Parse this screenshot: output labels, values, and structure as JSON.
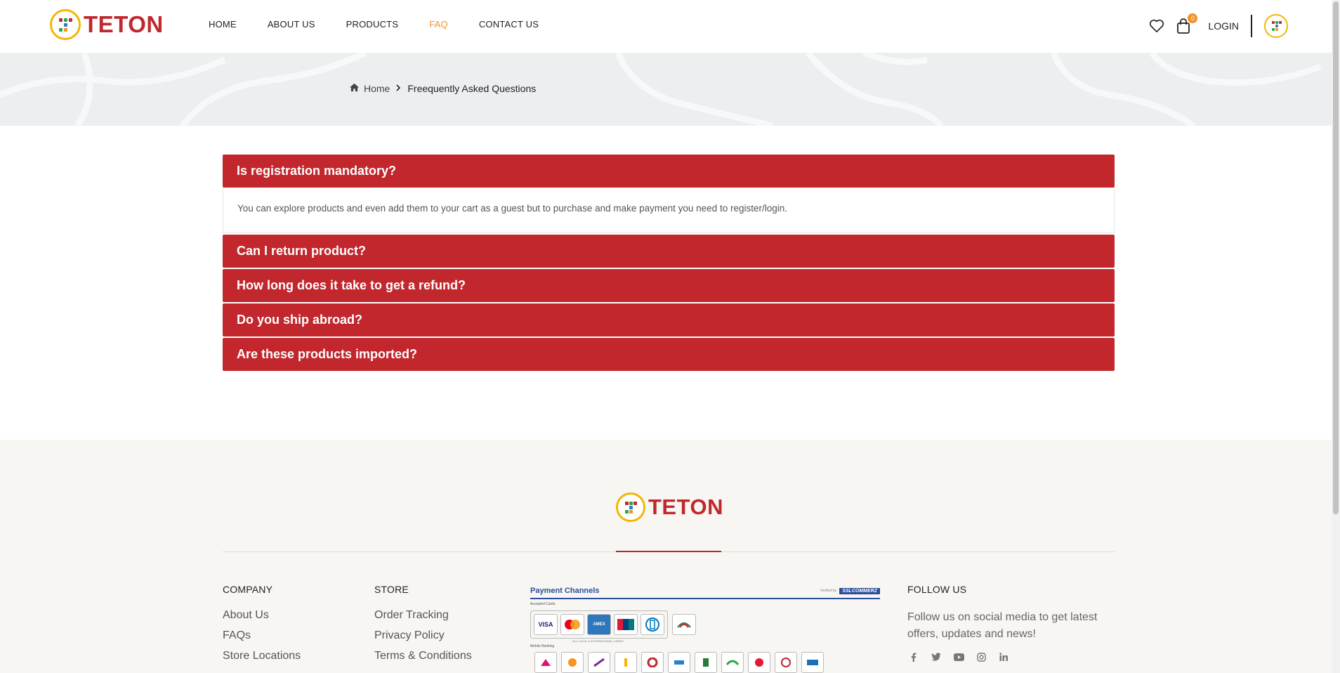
{
  "brand": {
    "name": "TETON",
    "primary": "#c1272d",
    "accent": "#f0932b",
    "logo_ring": "#f2b705"
  },
  "nav": {
    "items": [
      {
        "label": "HOME",
        "active": false
      },
      {
        "label": "ABOUT US",
        "active": false
      },
      {
        "label": "PRODUCTS",
        "active": false
      },
      {
        "label": "FAQ",
        "active": true
      },
      {
        "label": "CONTACT US",
        "active": false
      }
    ]
  },
  "header": {
    "wishlist_icon": "heart-icon",
    "cart_icon": "shopping-bag-icon",
    "cart_count": "0",
    "login_label": "LOGIN",
    "avatar_icon": "user-avatar-icon"
  },
  "breadcrumb": {
    "home_icon": "home-icon",
    "home_label": "Home",
    "separator_icon": "chevron-right-icon",
    "current": "Freequently Asked Questions"
  },
  "faq": {
    "items": [
      {
        "question": "Is registration mandatory?",
        "answer": "You can explore products and even add them to your cart as a guest but to purchase and make payment you need to register/login.",
        "expanded": true
      },
      {
        "question": "Can I return product?",
        "expanded": false
      },
      {
        "question": "How long does it take to get a refund?",
        "expanded": false
      },
      {
        "question": "Do you ship abroad?",
        "expanded": false
      },
      {
        "question": "Are these products imported?",
        "expanded": false
      }
    ]
  },
  "footer": {
    "company": {
      "title": "COMPANY",
      "links": [
        "About Us",
        "FAQs",
        "Store Locations"
      ]
    },
    "store": {
      "title": "STORE",
      "links": [
        "Order Tracking",
        "Privacy Policy",
        "Terms & Conditions"
      ]
    },
    "payment": {
      "title": "Payment Channels",
      "verified_by": "Verified by",
      "verifier": "SSLCOMMERZ",
      "accepted_label": "Accepted Cards",
      "cards": [
        "VISA",
        "mastercard",
        "AMEX",
        "UnionPay",
        "Diners",
        "DBBL NEXUS"
      ],
      "cards_caption": "ALL LOCAL & INTERNATIONAL CARDS",
      "mobile_label": "Mobile Banking"
    },
    "follow": {
      "title": "FOLLOW US",
      "text": "Follow us on social media to get latest offers, updates and news!",
      "icons": [
        "facebook-icon",
        "twitter-icon",
        "youtube-icon",
        "instagram-icon",
        "linkedin-icon"
      ]
    }
  }
}
